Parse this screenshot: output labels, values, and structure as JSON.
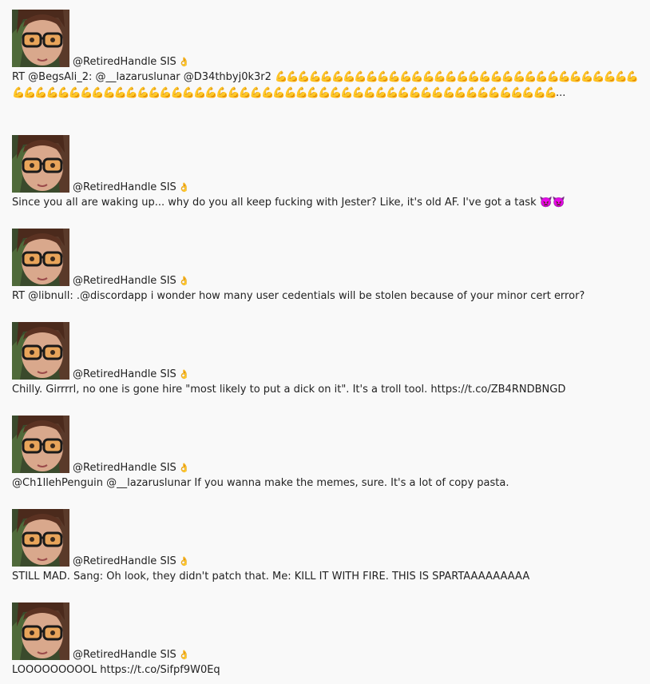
{
  "tweets": [
    {
      "handle": "@RetiredHandle SIS",
      "hand": "👌",
      "text": "RT @BegsAli_2: @__lazaruslunar @D34thbyj0k3r2 ",
      "emoji": "💪💪💪💪💪💪💪💪💪💪💪💪💪💪💪💪💪💪💪💪💪💪💪💪💪💪💪💪💪💪💪💪💪💪💪💪💪💪💪💪💪💪💪💪💪💪💪💪💪💪💪💪💪💪💪💪💪💪💪💪💪💪💪💪💪💪💪💪💪💪💪💪💪💪💪💪💪💪💪💪",
      "tail": "..."
    },
    {
      "handle": "@RetiredHandle SIS",
      "hand": "👌",
      "text": "Since you all are waking up... why do you all keep fucking with Jester? Like, it's old AF. I've got a task 👿👿"
    },
    {
      "handle": "@RetiredHandle SIS",
      "hand": "👌",
      "text": "RT @libnull: .@discordapp i wonder how many user cedentials will be stolen because of your minor cert error?"
    },
    {
      "handle": "@RetiredHandle SIS",
      "hand": "👌",
      "text": "Chilly. Girrrrl, no one is gone hire \"most likely to put a dick on it\". It's a troll tool. https://t.co/ZB4RNDBNGD"
    },
    {
      "handle": "@RetiredHandle SIS",
      "hand": "👌",
      "text": "@Ch1llehPenguin @__lazaruslunar If you wanna make the memes, sure. It's a lot of copy pasta."
    },
    {
      "handle": "@RetiredHandle SIS",
      "hand": "👌",
      "text": "STILL MAD. Sang: Oh look, they didn't patch that. Me: KILL IT WITH FIRE. THIS IS SPARTAAAAAAAAA"
    },
    {
      "handle": "@RetiredHandle SIS",
      "hand": "👌",
      "text": "LOOOOOOOOOL https://t.co/Sifpf9W0Eq"
    }
  ]
}
